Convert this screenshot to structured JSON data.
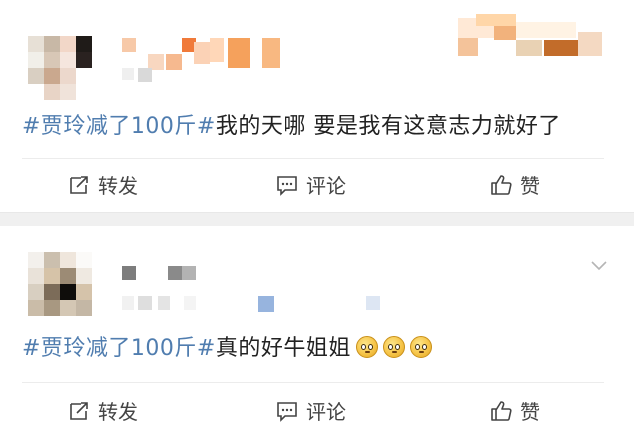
{
  "posts": [
    {
      "content": {
        "topic": "#贾玲减了100斤#",
        "text": "我的天哪 要是我有这意志力就好了",
        "emoji_count": 0
      },
      "actions": {
        "repost": "转发",
        "comment": "评论",
        "like": "赞"
      }
    },
    {
      "content": {
        "topic": "#贾玲减了100斤#",
        "text": "真的好牛姐姐",
        "emoji_count": 3
      },
      "actions": {
        "repost": "转发",
        "comment": "评论",
        "like": "赞"
      }
    }
  ],
  "colors": {
    "topic_link": "#507daf",
    "text": "#222222",
    "action_text": "#444444",
    "separator": "#f0f0f0"
  },
  "icons": [
    "repost-icon",
    "comment-icon",
    "like-icon",
    "chevron-down-icon",
    "emoji-pleading-face-icon"
  ]
}
